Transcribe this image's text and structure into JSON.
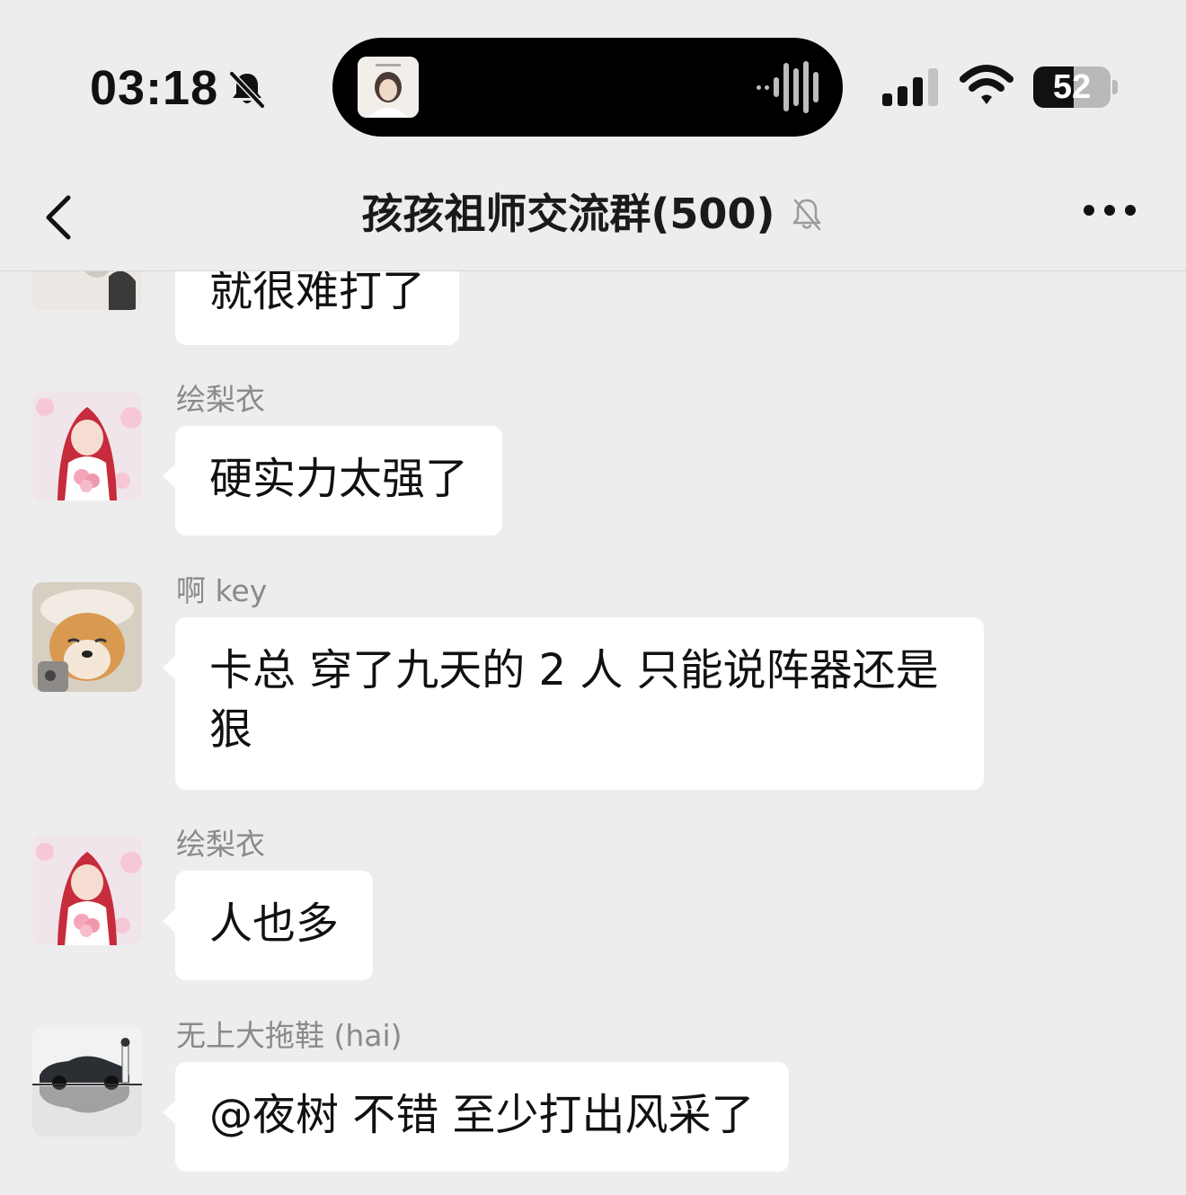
{
  "status_bar": {
    "time": "03:18",
    "battery_level": "52",
    "battery_fraction": 0.52
  },
  "nav": {
    "title": "孩孩祖师交流群(500)"
  },
  "messages": [
    {
      "sender": "",
      "text": "就很难打了",
      "avatar": "plush-bear-avatar"
    },
    {
      "sender": "绘梨衣",
      "text": "硬实力太强了",
      "avatar": "anime-girl-avatar"
    },
    {
      "sender": "啊 key",
      "text": "卡总 穿了九天的 2 人 只能说阵器还是狠",
      "avatar": "shiba-dog-avatar"
    },
    {
      "sender": "绘梨衣",
      "text": "人也多",
      "avatar": "anime-girl-avatar"
    },
    {
      "sender": "无上大拖鞋 (hai)",
      "text": "@夜树 不错 至少打出风采了",
      "avatar": "car-avatar"
    }
  ],
  "colors": {
    "background": "#ededed",
    "bubble": "#ffffff",
    "sender_name": "#8a8a8a"
  }
}
